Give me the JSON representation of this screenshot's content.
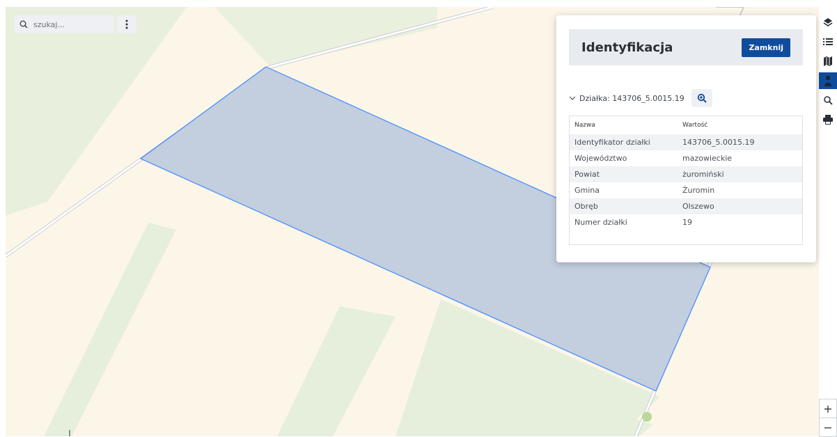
{
  "search": {
    "placeholder": "szukaj..."
  },
  "panel": {
    "title": "Identyfikacja",
    "close_label": "Zamknij",
    "section_label": "Działka: 143706_5.0015.19",
    "table": {
      "headers": [
        "Nazwa",
        "Wartość"
      ],
      "rows": [
        [
          "Identyfikator działki",
          "143706_5.0015.19"
        ],
        [
          "Województwo",
          "mazowieckie"
        ],
        [
          "Powiat",
          "żuromiński"
        ],
        [
          "Gmina",
          "Żuromin"
        ],
        [
          "Obręb",
          "Olszewo"
        ],
        [
          "Numer działki",
          "19"
        ]
      ]
    }
  },
  "toolbar": {
    "tools": [
      "layers-icon",
      "list-icon",
      "map-icon",
      "person-icon",
      "search-icon",
      "print-icon"
    ],
    "active_tool": "person-icon"
  },
  "zoom": {
    "in_label": "+",
    "out_label": "−"
  },
  "colors": {
    "accent": "#0f4c9c",
    "parcel_fill": "#c3cede",
    "parcel_stroke": "#3d8bff",
    "map_background": "#fcf6e9",
    "forest": "#e6efdc"
  }
}
